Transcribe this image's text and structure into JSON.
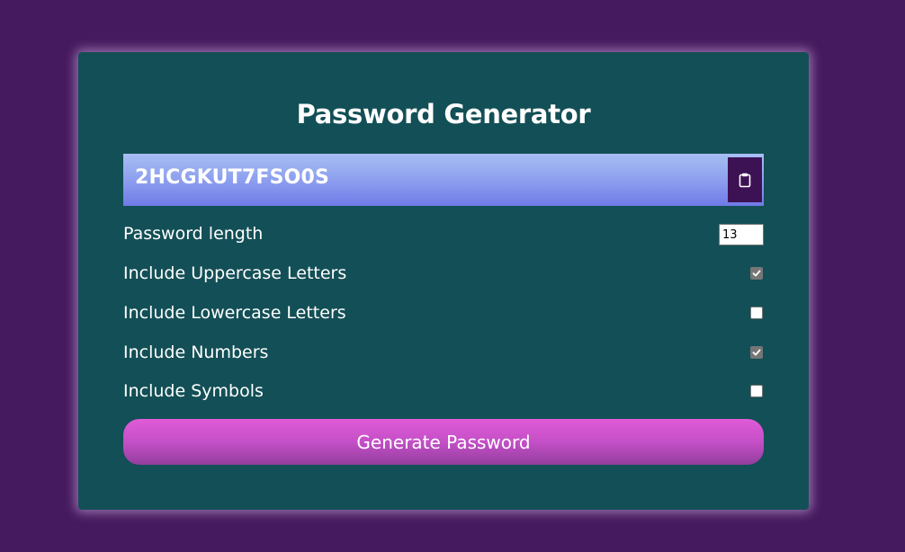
{
  "app": {
    "title": "Password Generator"
  },
  "result": {
    "password": "2HCGKUT7FSO0S",
    "copy_icon": "clipboard-icon"
  },
  "settings": {
    "length": {
      "label": "Password length",
      "value": "13"
    },
    "uppercase": {
      "label": "Include Uppercase Letters",
      "checked": true
    },
    "lowercase": {
      "label": "Include Lowercase Letters",
      "checked": false
    },
    "numbers": {
      "label": "Include Numbers",
      "checked": true
    },
    "symbols": {
      "label": "Include Symbols",
      "checked": false
    }
  },
  "actions": {
    "generate_label": "Generate Password"
  },
  "colors": {
    "page_background": "#461a5e",
    "card_background": "#134f56",
    "copy_button": "#3d1254",
    "generate_button": "#c44fc7"
  }
}
